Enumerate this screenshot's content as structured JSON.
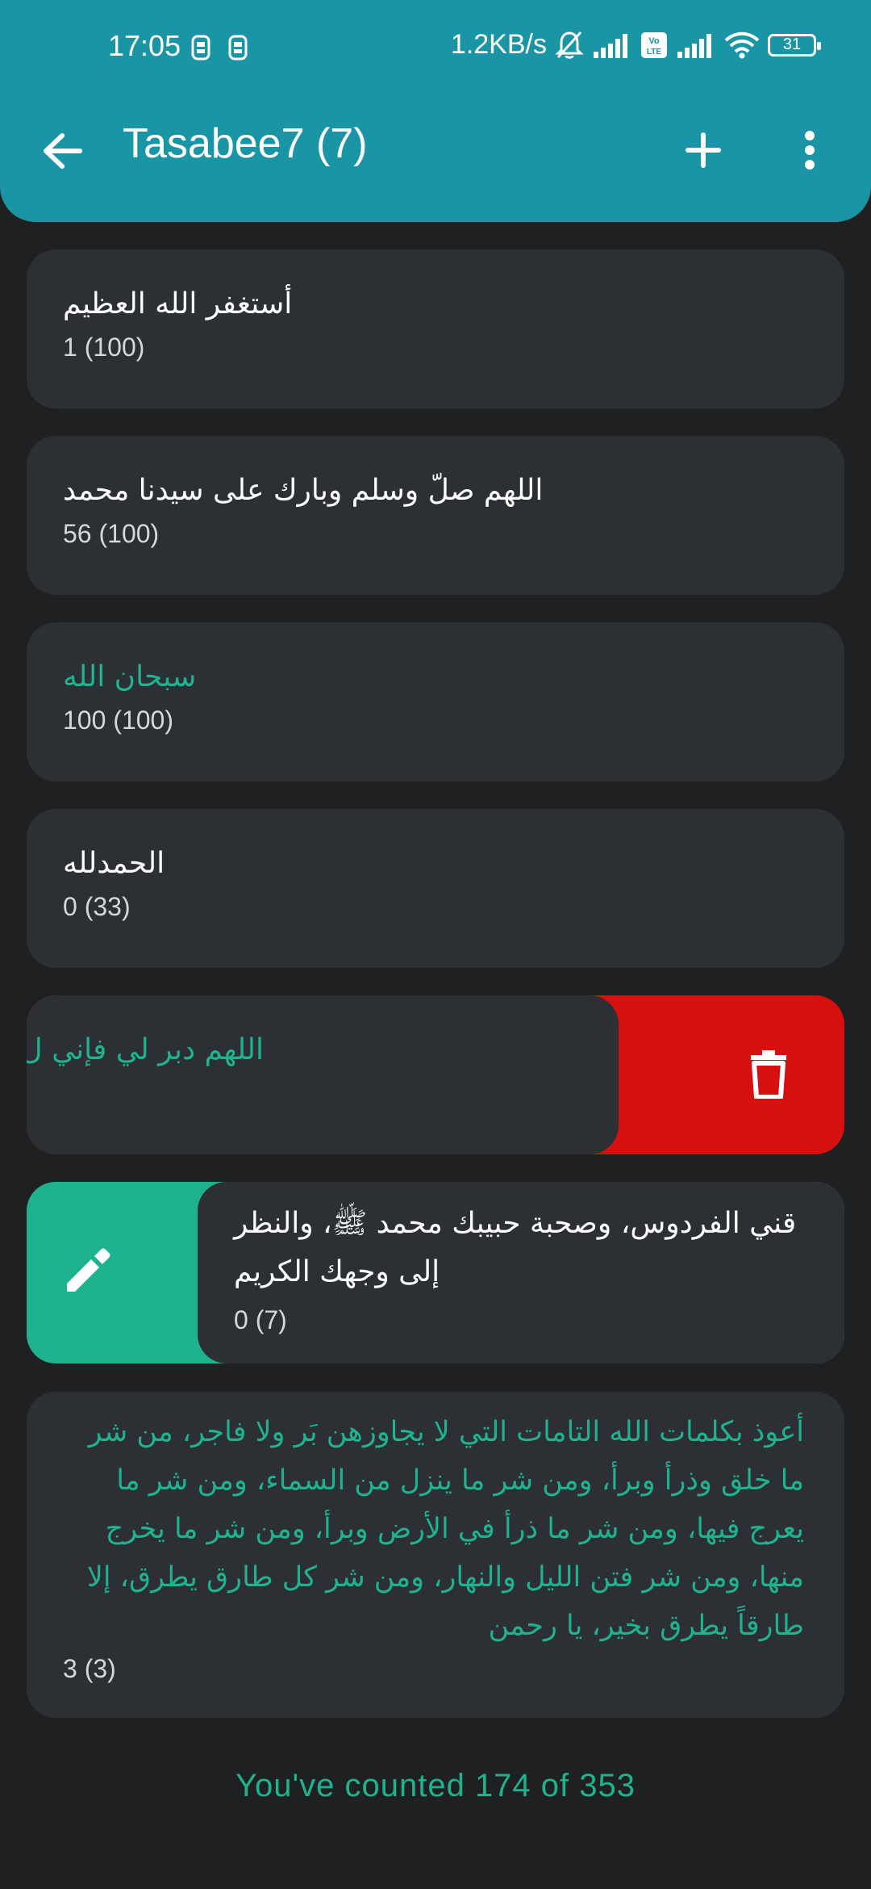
{
  "status_bar": {
    "time": "17:05",
    "network_speed": "1.2KB/s",
    "battery": "31",
    "icons": [
      "sim-icon",
      "sim-icon",
      "muted-bell-icon",
      "signal-icon",
      "volte-icon",
      "signal-icon",
      "wifi-icon",
      "battery-icon"
    ]
  },
  "toolbar": {
    "title": "Tasabee7 (7)",
    "back_icon": "arrow-back-icon",
    "add_icon": "plus-icon",
    "more_icon": "more-vert-icon"
  },
  "colors": {
    "appbar": "#1a95a6",
    "background": "#1f2022",
    "card": "#2c2f33",
    "accent": "#1fb28f",
    "delete": "#d60f0f"
  },
  "items": [
    {
      "title": "أستغفر الله العظيم",
      "count": "1 (100)",
      "completed": false
    },
    {
      "title": "اللهم صلّ وسلم وبارك على سيدنا محمد",
      "count": "56 (100)",
      "completed": false
    },
    {
      "title": "سبحان الله",
      "count": "100 (100)",
      "completed": true
    },
    {
      "title": "الحمدلله",
      "count": "0 (33)",
      "completed": false
    },
    {
      "title": "اللهم دبر لي فإني ل",
      "count": "",
      "completed": true,
      "swiped": "delete"
    },
    {
      "title_line1": "قني الفردوس، وصحبة حبيبك محمد ﷺ، والنظر",
      "title_line2": "إلى وجهك الكريم",
      "count": "0 (7)",
      "completed": false,
      "swiped": "edit"
    },
    {
      "title": "أعوذ بكلمات الله التامات التي لا يجاوزهن بَر ولا فاجر، من شر ما خلق وذرأ وبرأ، ومن شر ما ينزل من السماء، ومن شر ما يعرج فيها، ومن شر ما ذرأ في الأرض وبرأ، ومن شر ما يخرج منها، ومن شر فتن الليل والنهار، ومن شر كل طارق يطرق، إلا طارقاً يطرق بخير، يا رحمن",
      "count": "3 (3)",
      "completed": true
    }
  ],
  "footer": {
    "text": "You've counted 174 of 353"
  }
}
